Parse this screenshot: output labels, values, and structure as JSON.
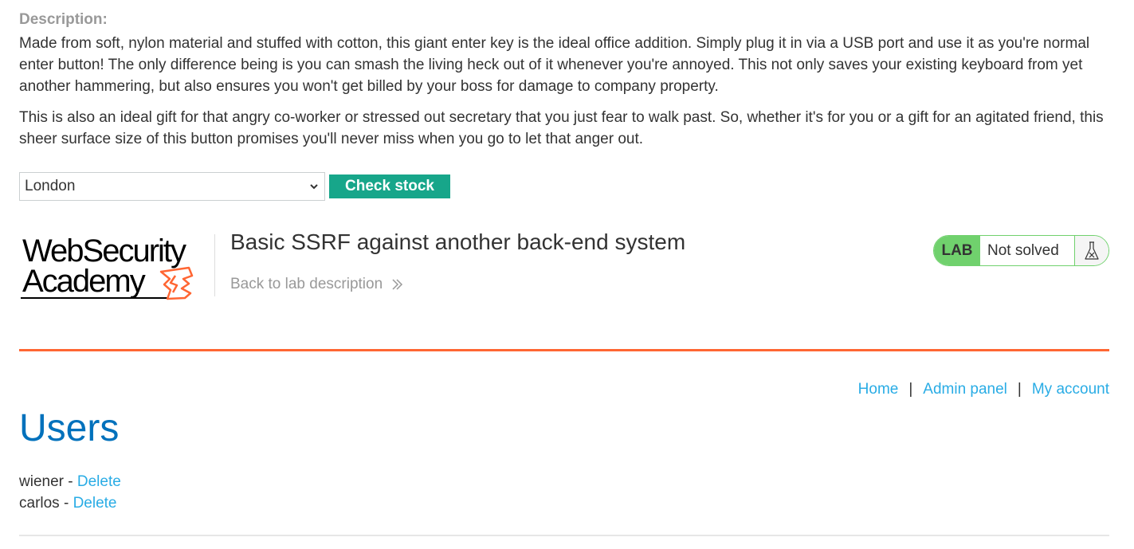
{
  "description": {
    "label": "Description:",
    "paragraphs": [
      "Made from soft, nylon material and stuffed with cotton, this giant enter key is the ideal office addition. Simply plug it in via a USB port and use it as you're normal enter button! The only difference being is you can smash the living heck out of it whenever you're annoyed. This not only saves your existing keyboard from yet another hammering, but also ensures you won't get billed by your boss for damage to company property.",
      "This is also an ideal gift for that angry co-worker or stressed out secretary that you just fear to walk past. So, whether it's for you or a gift for an agitated friend, this sheer surface size of this button promises you'll never miss when you go to let that anger out."
    ]
  },
  "stock_check": {
    "selected_store": "London",
    "button_label": "Check stock"
  },
  "academy": {
    "logo_line1": "WebSecurity",
    "logo_line2": "Academy",
    "lab_title": "Basic SSRF against another back-end system",
    "back_link": "Back to lab description",
    "lab_badge": "LAB",
    "lab_status": "Not solved",
    "colors": {
      "accent_orange": "#ff6633",
      "lab_green": "#70d16d",
      "button_teal": "#17a68a",
      "link_blue": "#29ace5",
      "heading_blue": "#0071bc"
    }
  },
  "nav": {
    "home": "Home",
    "admin_panel": "Admin panel",
    "my_account": "My account",
    "separator": "|"
  },
  "users": {
    "heading": "Users",
    "list": [
      {
        "name": "wiener",
        "dash": "-",
        "action": "Delete"
      },
      {
        "name": "carlos",
        "dash": "-",
        "action": "Delete"
      }
    ]
  }
}
